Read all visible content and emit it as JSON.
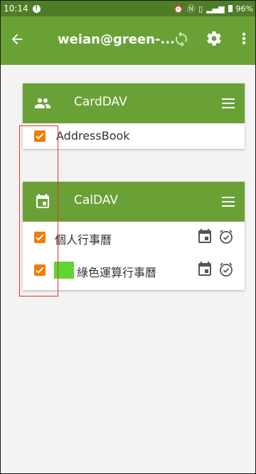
{
  "status_bar": {
    "time": "10:14",
    "alert_icon": "!",
    "icons": [
      "alarm-icon",
      "nfc-icon",
      "vibrate-icon",
      "signal-icon"
    ],
    "battery": "96%"
  },
  "toolbar": {
    "back_icon": "arrow-back-icon",
    "title": "weian@green-...",
    "actions": [
      "sync-icon",
      "settings-icon",
      "more-vert-icon"
    ]
  },
  "carddav": {
    "title": "CardDAV",
    "items": [
      {
        "label": "AddressBook",
        "checked": true
      }
    ]
  },
  "caldav": {
    "title": "CalDAV",
    "items": [
      {
        "label": "個人行事曆",
        "checked": true,
        "color": null
      },
      {
        "label": "綠色運算行事曆",
        "checked": true,
        "color": "#5fd630"
      }
    ]
  },
  "colors": {
    "accent": "#6aa136",
    "status_bar": "#4f7d27",
    "checkbox": "#f57c00",
    "annotation": "#e0332f"
  }
}
